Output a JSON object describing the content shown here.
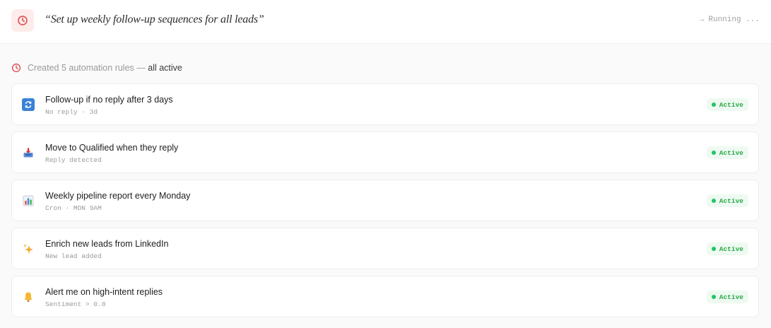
{
  "header": {
    "icon": "clock-icon",
    "accent": "#e0464b",
    "prompt": "“Set up weekly follow-up sequences for all leads”",
    "status_arrow": "→",
    "status_text": "Running ..."
  },
  "summary": {
    "icon": "clock-icon",
    "muted_text": "Created 5 automation rules —",
    "strong_text": "all active"
  },
  "rules": [
    {
      "icon": "refresh-arrows-icon",
      "title": "Follow-up if no reply after 3 days",
      "subtitle": "No reply · 3d",
      "status": "Active"
    },
    {
      "icon": "inbox-tray-icon",
      "title": "Move to Qualified when they reply",
      "subtitle": "Reply detected",
      "status": "Active"
    },
    {
      "icon": "bar-chart-icon",
      "title": "Weekly pipeline report every Monday",
      "subtitle": "Cron · MON 9AM",
      "status": "Active"
    },
    {
      "icon": "sparkles-icon",
      "title": "Enrich new leads from LinkedIn",
      "subtitle": "New lead added",
      "status": "Active"
    },
    {
      "icon": "bell-icon",
      "title": "Alert me on high-intent replies",
      "subtitle": "Sentiment > 0.8",
      "status": "Active"
    }
  ],
  "colors": {
    "active_text": "#2aa84a",
    "active_dot": "#22c55e",
    "active_bg": "#eefaf1"
  }
}
